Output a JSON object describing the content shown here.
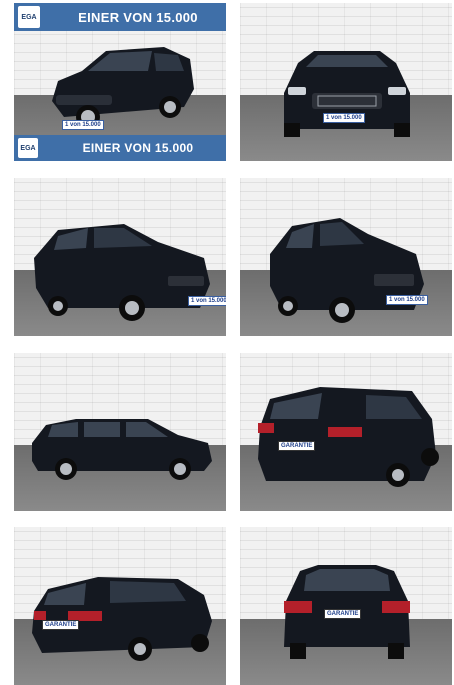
{
  "gallery": {
    "banner_top_text": "EINER VON 15.000",
    "banner_bottom_text": "EINER VON 15.000",
    "logo_text": "EGA",
    "plate_text": "1 von 15.000",
    "garantie_text": "GARANTIE",
    "photos": [
      {
        "view": "front-left three-quarter"
      },
      {
        "view": "front"
      },
      {
        "view": "front-right three-quarter"
      },
      {
        "view": "front-right three-quarter close"
      },
      {
        "view": "side"
      },
      {
        "view": "rear-right three-quarter"
      },
      {
        "view": "rear-left three-quarter"
      },
      {
        "view": "rear"
      }
    ]
  },
  "colors": {
    "banner": "#3f6fa8",
    "car": "#141820"
  }
}
